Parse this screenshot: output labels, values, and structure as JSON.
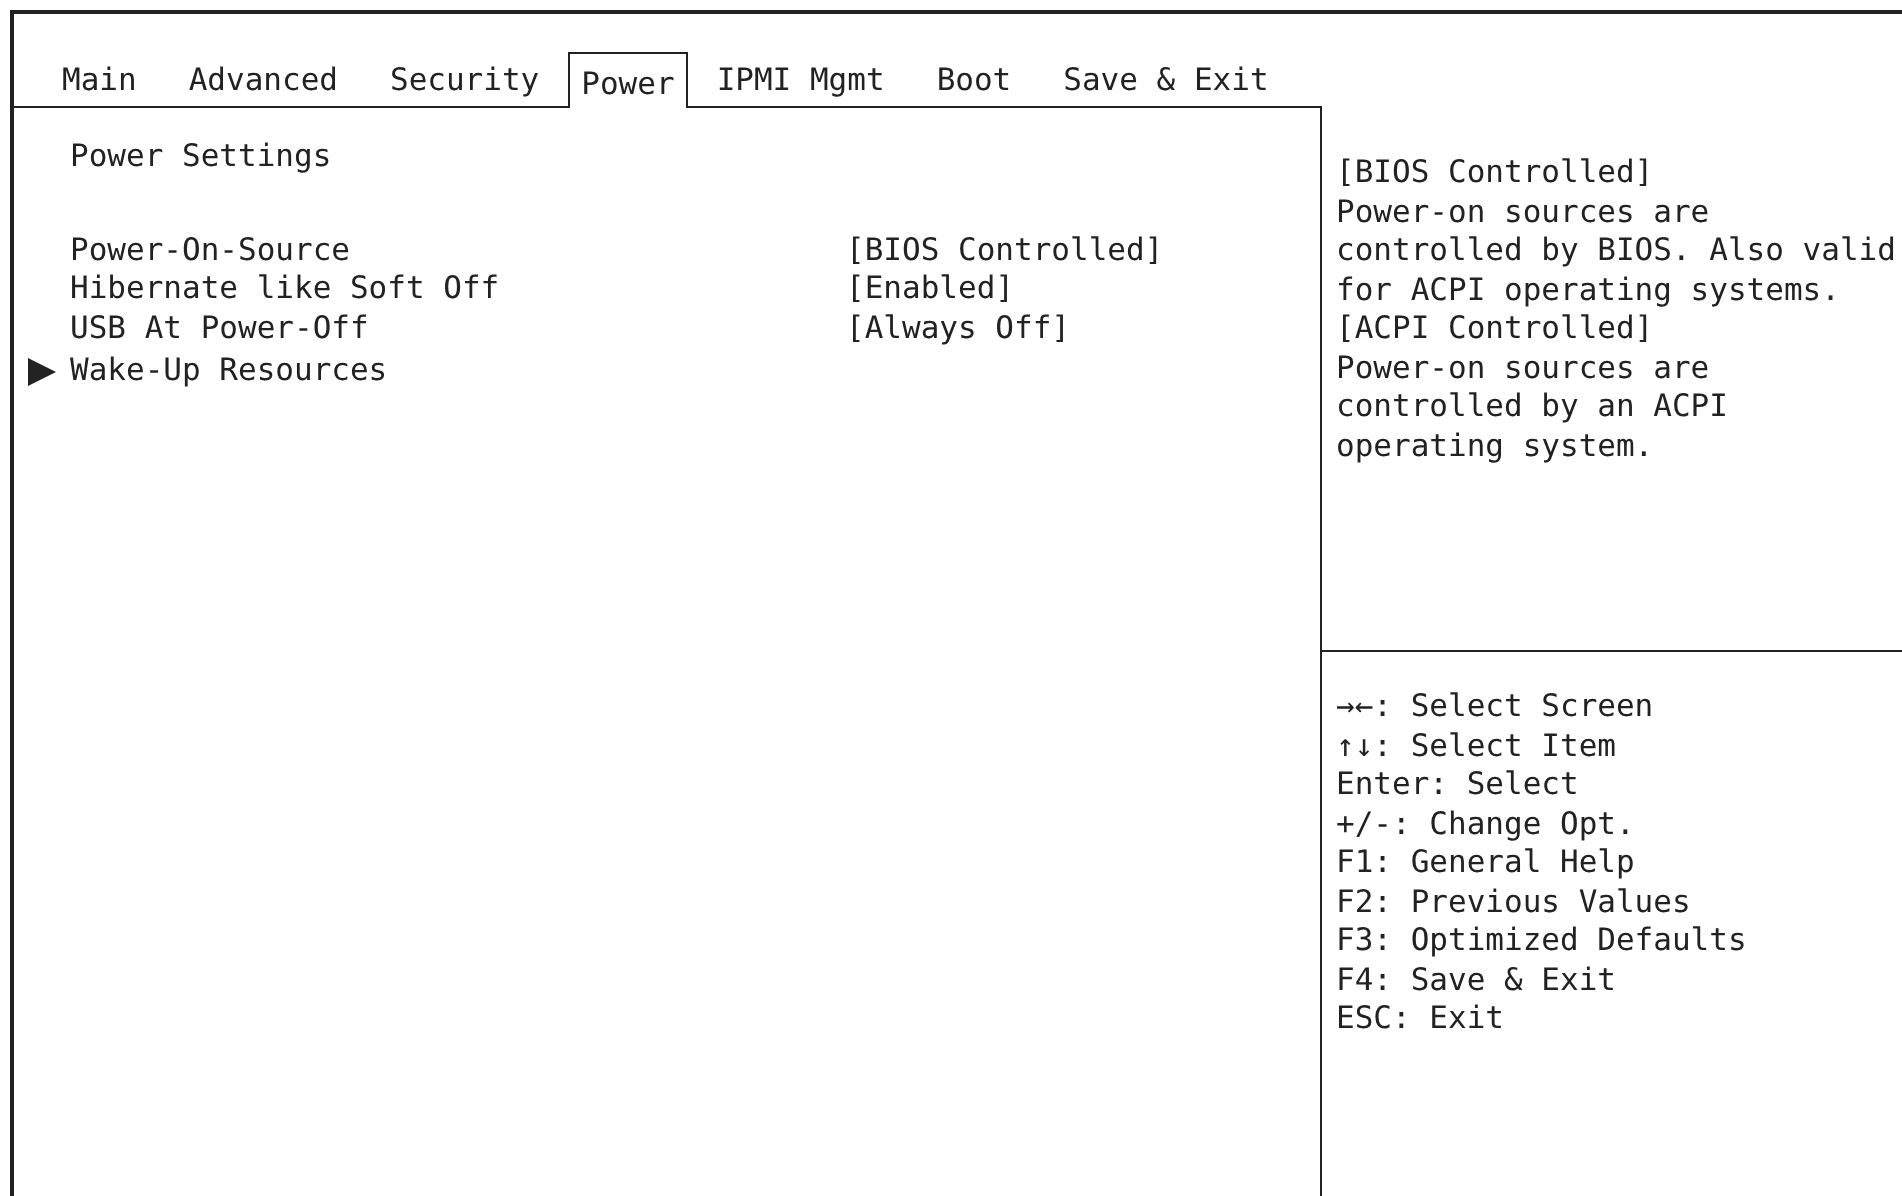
{
  "tabs": [
    {
      "label": "Main",
      "selected": false
    },
    {
      "label": "Advanced",
      "selected": false
    },
    {
      "label": "Security",
      "selected": false
    },
    {
      "label": "Power",
      "selected": true
    },
    {
      "label": "IPMI Mgmt",
      "selected": false
    },
    {
      "label": "Boot",
      "selected": false
    },
    {
      "label": "Save & Exit",
      "selected": false
    }
  ],
  "section_title": "Power Settings",
  "items": [
    {
      "kind": "setting",
      "label": "Power-On-Source",
      "value": "[BIOS Controlled]"
    },
    {
      "kind": "setting",
      "label": "Hibernate like Soft Off",
      "value": "[Enabled]"
    },
    {
      "kind": "setting",
      "label": "USB At Power-Off",
      "value": "[Always Off]"
    },
    {
      "kind": "submenu",
      "label": "Wake-Up Resources"
    }
  ],
  "help_text": [
    "[BIOS Controlled]",
    "Power-on sources are",
    "controlled by BIOS. Also valid",
    "for ACPI operating systems.",
    "[ACPI Controlled]",
    "Power-on sources are",
    "controlled by an ACPI",
    "operating system."
  ],
  "key_help": [
    "→←: Select Screen",
    "↑↓: Select Item",
    "Enter: Select",
    "+/-: Change Opt.",
    "F1: General Help",
    "F2: Previous Values",
    "F3: Optimized Defaults",
    "F4: Save & Exit",
    "ESC: Exit"
  ]
}
